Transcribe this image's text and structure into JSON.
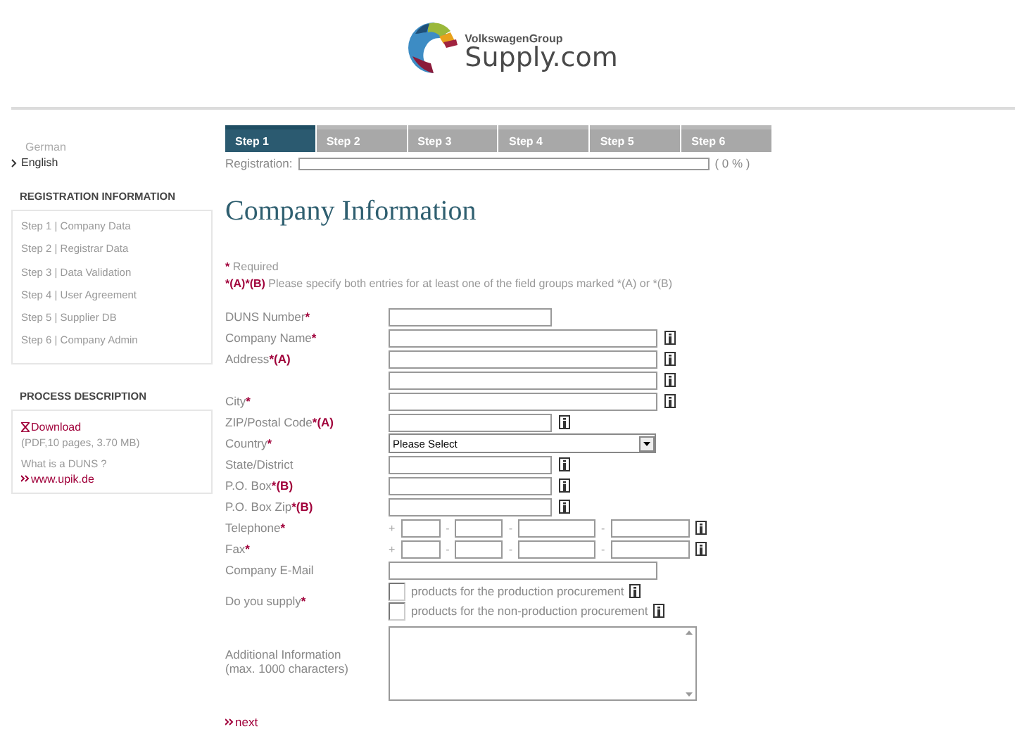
{
  "logo": {
    "group": "VolkswagenGroup",
    "brand": "Supply.com"
  },
  "languages": [
    {
      "label": "German",
      "selected": false
    },
    {
      "label": "English",
      "selected": true
    }
  ],
  "sidebar": {
    "registration_title": "REGISTRATION INFORMATION",
    "steps": [
      "Step 1 | Company Data",
      "Step 2 | Registrar Data",
      "Step 3 | Data Validation",
      "Step 4 | User Agreement",
      "Step 5 | Supplier DB",
      "Step 6 | Company Admin"
    ],
    "process_title": "PROCESS DESCRIPTION",
    "download": "Download",
    "download_info": "(PDF,10 pages, 3.70 MB)",
    "duns_question": "What is a DUNS ?",
    "duns_link": "www.upik.de"
  },
  "tabs": [
    {
      "label": "Step 1",
      "selected": true
    },
    {
      "label": "Step 2",
      "selected": false
    },
    {
      "label": "Step 3",
      "selected": false
    },
    {
      "label": "Step 4",
      "selected": false
    },
    {
      "label": "Step 5",
      "selected": false
    },
    {
      "label": "Step 6",
      "selected": false
    }
  ],
  "progress": {
    "label": "Registration:",
    "level": 0,
    "reading": "( 0 % )"
  },
  "heading": "Company Information",
  "required_note": {
    "mark": "*",
    "text": "Required"
  },
  "group_note": {
    "mark": "*(A)*(B)",
    "text": "Please specify both entries for at least one of the field groups marked *(A) or *(B)"
  },
  "fields": [
    {
      "kind": "text",
      "label": "DUNS Number",
      "mark": "*",
      "wide": false,
      "info": false
    },
    {
      "kind": "text",
      "label": "Company Name",
      "mark": "*",
      "wide": true,
      "info": true
    },
    {
      "kind": "text",
      "label": "Address",
      "mark": "*(A)",
      "wide": true,
      "info": true
    },
    {
      "kind": "text",
      "wide": true,
      "info": true
    },
    {
      "kind": "text",
      "label": "City",
      "mark": "*",
      "wide": true,
      "info": true
    },
    {
      "kind": "text",
      "label": "ZIP/Postal Code",
      "mark": "*(A)",
      "wide": false,
      "info": true
    },
    {
      "kind": "select",
      "label": "Country",
      "mark": "*",
      "value": "Please Select"
    },
    {
      "kind": "text",
      "label": "State/District",
      "wide": false,
      "info": true
    },
    {
      "kind": "text",
      "label": "P.O. Box",
      "mark": "*(B)",
      "wide": false,
      "info": true
    },
    {
      "kind": "text",
      "label": "P.O. Box Zip",
      "mark": "*(B)",
      "wide": false,
      "info": true
    },
    {
      "kind": "phone",
      "label": "Telephone",
      "mark": "*",
      "prefix": "+",
      "separator": "-",
      "info": true
    },
    {
      "kind": "phone",
      "label": "Fax",
      "mark": "*",
      "prefix": "+",
      "separator": "-",
      "info": true
    },
    {
      "kind": "text",
      "label": "Company E-Mail",
      "wide": true,
      "info": false
    },
    {
      "kind": "checkboxes",
      "label": "Do you supply",
      "mark": "*",
      "options": [
        {
          "label": "products for the production procurement",
          "checked": false
        },
        {
          "label": "products for the non-production procurement",
          "checked": false
        }
      ]
    },
    {
      "kind": "textarea",
      "label": "Additional Information",
      "sublabel": "(max. 1000 characters)"
    }
  ],
  "next": "next"
}
